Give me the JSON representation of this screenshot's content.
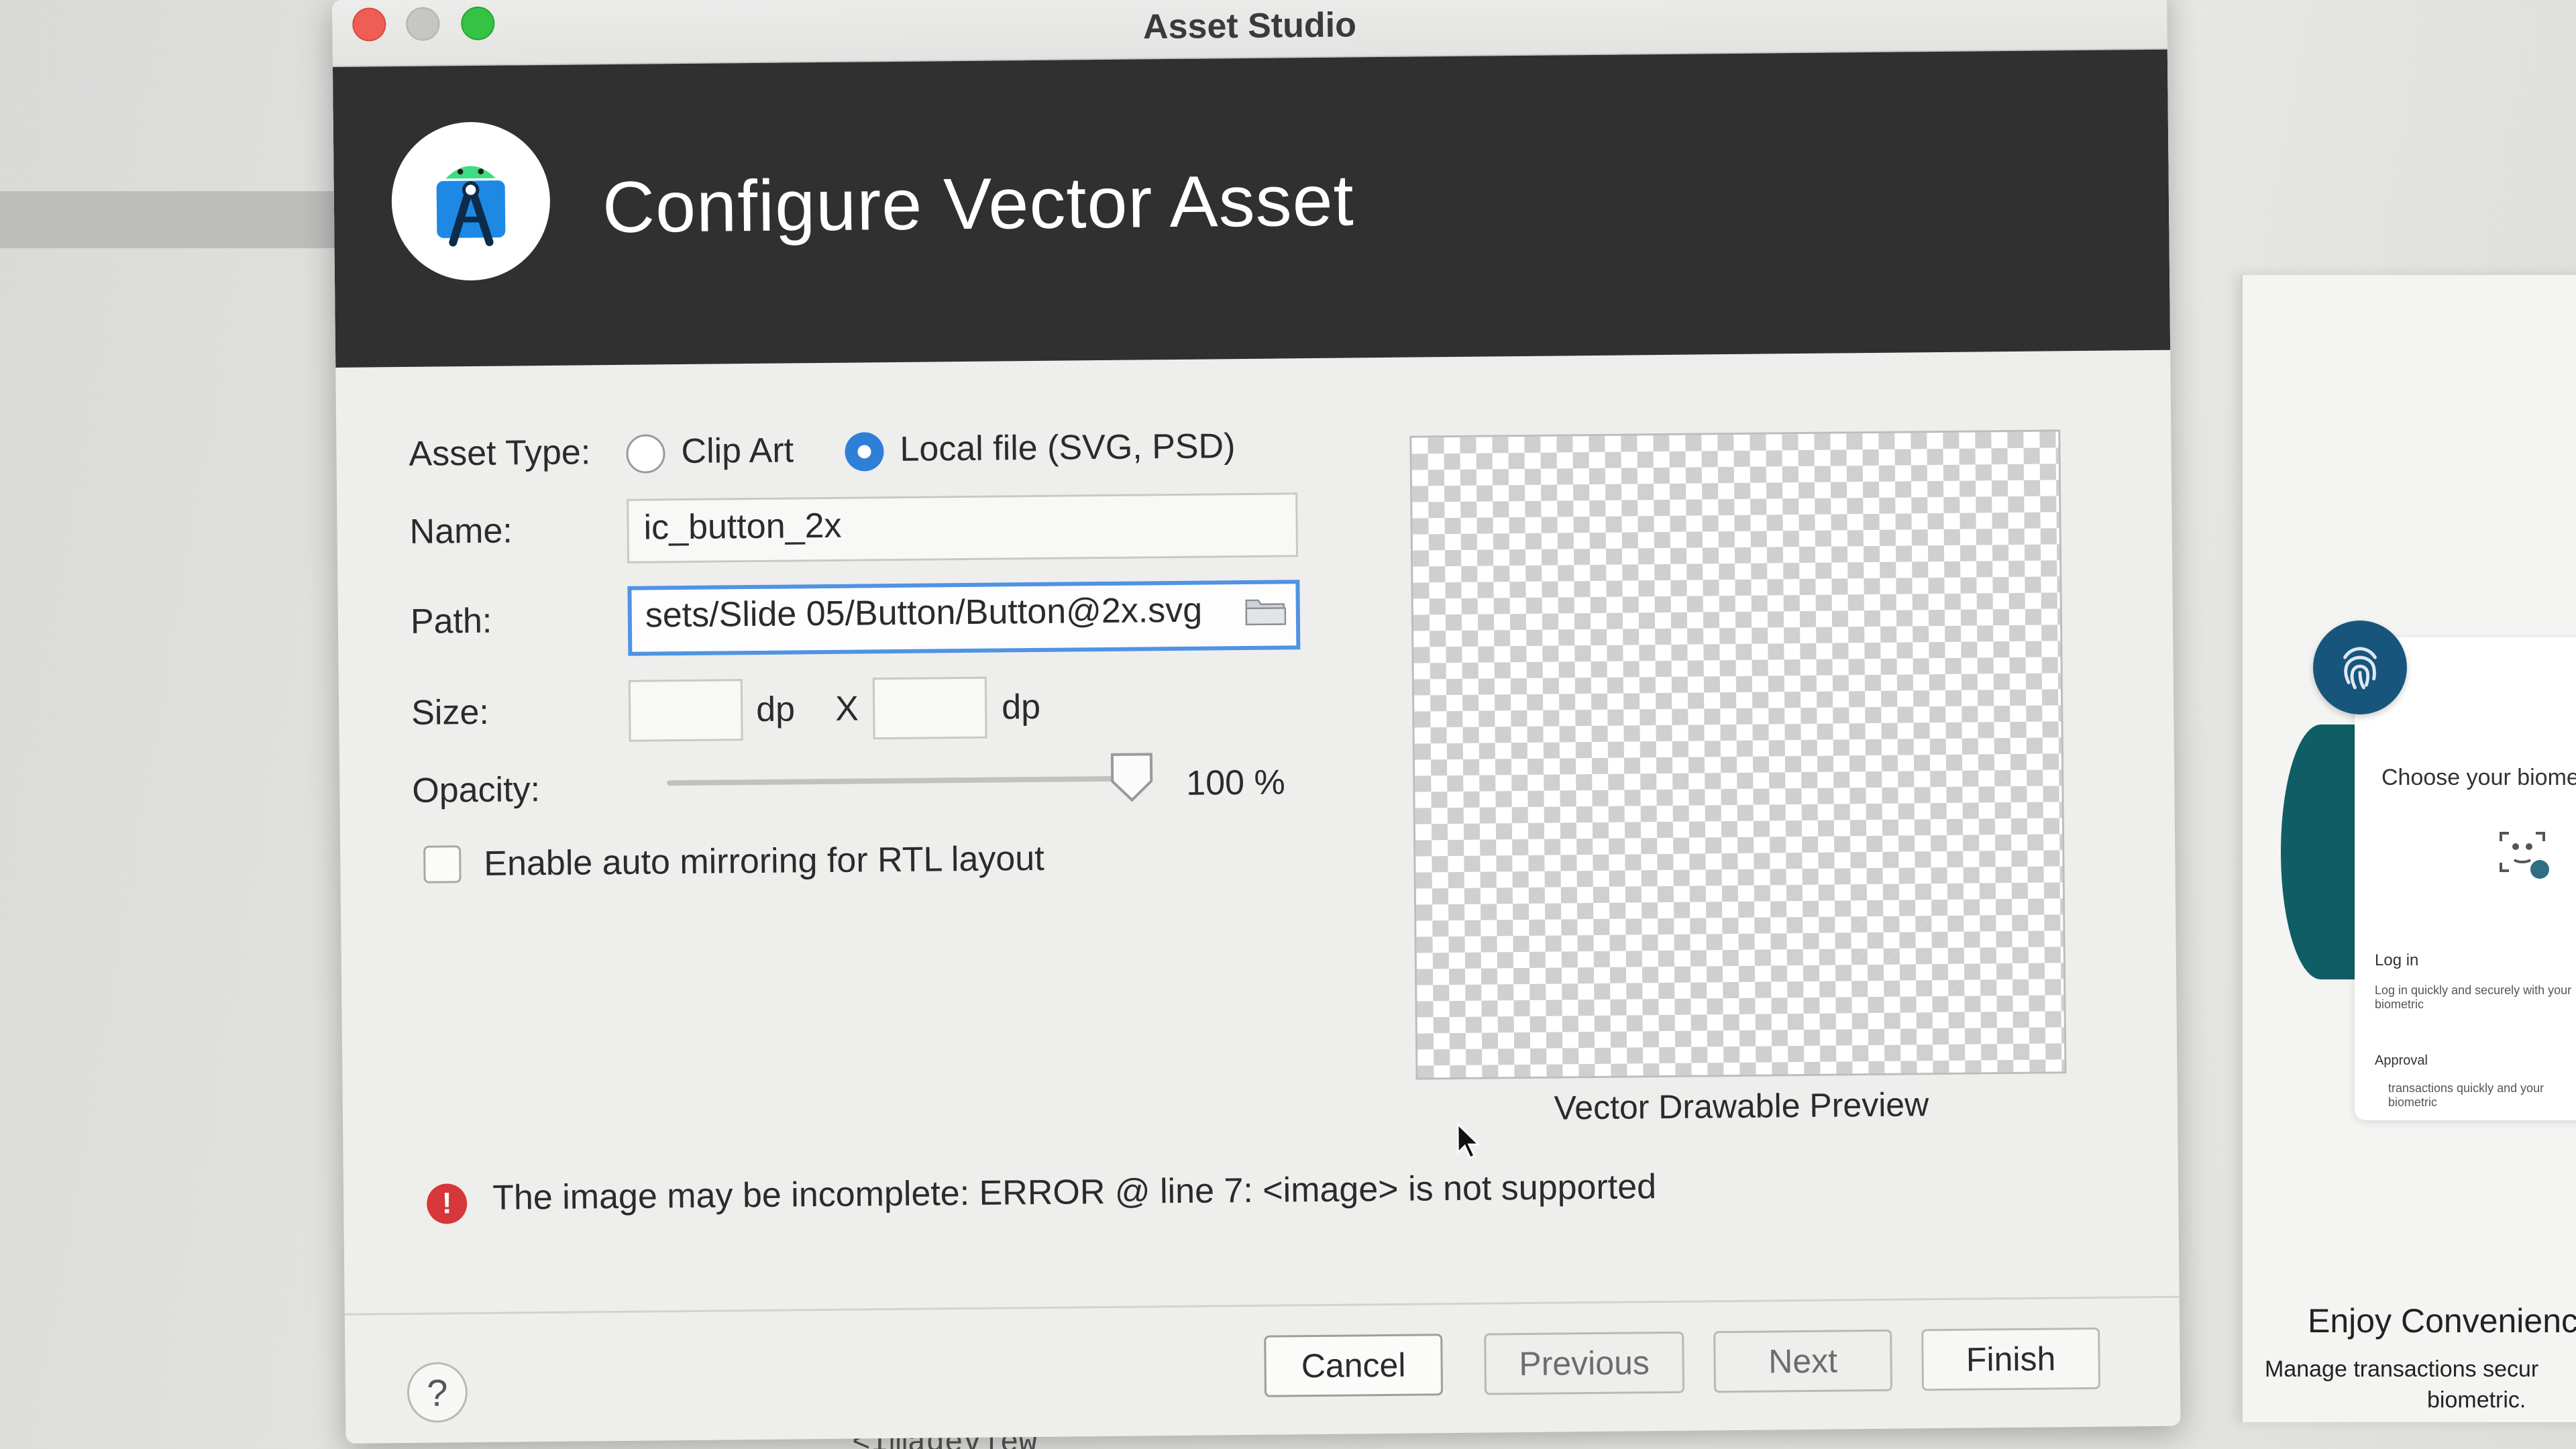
{
  "window": {
    "title": "Asset Studio"
  },
  "header": {
    "title": "Configure Vector Asset",
    "logo_icon": "android-studio-icon"
  },
  "form": {
    "asset_type": {
      "label": "Asset Type:",
      "options": [
        {
          "label": "Clip Art",
          "selected": false
        },
        {
          "label": "Local file (SVG, PSD)",
          "selected": true
        }
      ]
    },
    "name": {
      "label": "Name:",
      "value": "ic_button_2x"
    },
    "path": {
      "label": "Path:",
      "value": "sets/Slide 05/Button/Button@2x.svg",
      "icon": "folder-icon"
    },
    "size": {
      "label": "Size:",
      "width_value": "",
      "height_value": "",
      "unit": "dp",
      "separator": "X"
    },
    "opacity": {
      "label": "Opacity:",
      "value": 100,
      "display": "100 %"
    },
    "auto_mirroring": {
      "label": "Enable auto mirroring for RTL layout",
      "checked": false
    }
  },
  "preview": {
    "label": "Vector Drawable Preview"
  },
  "error": {
    "icon": "error-icon",
    "message": "The image may be incomplete: ERROR @ line 7: <image> is not supported"
  },
  "footer": {
    "help_label": "?",
    "buttons": {
      "cancel": "Cancel",
      "previous": "Previous",
      "next": "Next",
      "finish": "Finish"
    }
  },
  "background": {
    "code_snippet": "<ImageView",
    "phone_choose": "Choose your biomet",
    "phone_login": "Log in",
    "phone_login_sub": "Log in quickly and securely with your biometric",
    "phone_approval": "Approval",
    "phone_approval_sub": "transactions quickly and your biometric",
    "enjoy": "Enjoy Convenienc",
    "manage": "Manage transactions secur",
    "biometric": "biometric."
  },
  "colors": {
    "header_bg": "#303030",
    "accent": "#2f7fd8",
    "error": "#d6373a",
    "close": "#f05d55",
    "maximize": "#36c245"
  }
}
